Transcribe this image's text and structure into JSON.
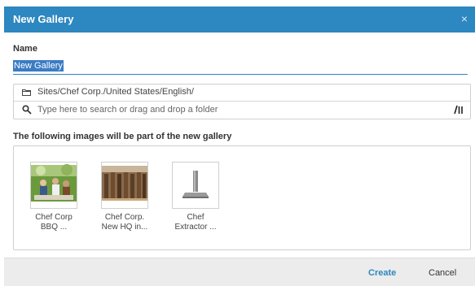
{
  "dialog": {
    "title": "New Gallery",
    "close_glyph": "×",
    "name_label": "Name",
    "name_value": "New Gallery",
    "folder_path": "Sites/Chef Corp./United States/English/",
    "search_placeholder": "Type here to search or drag and drop a folder",
    "section_label": "The following images will be part of the new gallery",
    "images": [
      {
        "caption": "Chef Corp\nBBQ     ...",
        "icon": "bbq-photo"
      },
      {
        "caption": "Chef Corp.\nNew HQ in...",
        "icon": "building-photo"
      },
      {
        "caption": "Chef\nExtractor ...",
        "icon": "extractor-photo"
      }
    ],
    "create_label": "Create",
    "cancel_label": "Cancel"
  },
  "colors": {
    "header_bg": "#2d87c0",
    "accent": "#2d87c0",
    "footer_bg": "#ececec"
  }
}
